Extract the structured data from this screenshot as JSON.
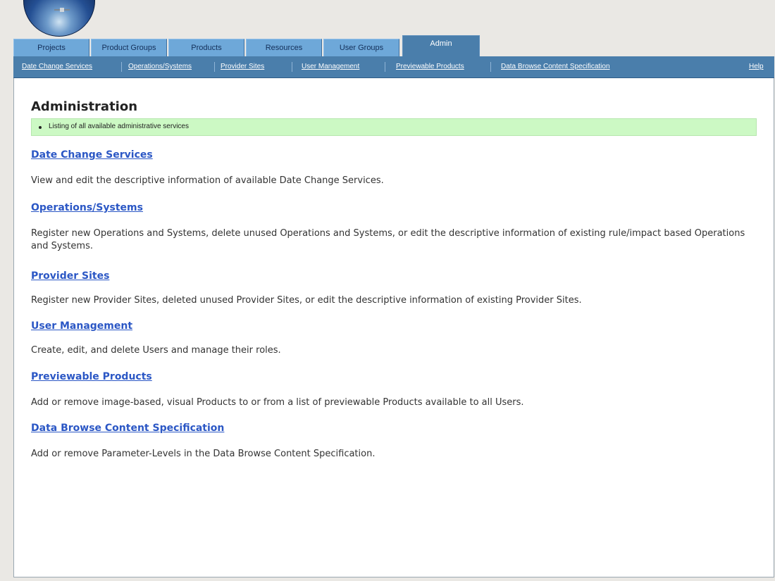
{
  "logo_icon": "globe-satellite-logo",
  "tabs": [
    {
      "label": "Projects"
    },
    {
      "label": "Product Groups"
    },
    {
      "label": "Products"
    },
    {
      "label": "Resources"
    },
    {
      "label": "User Groups"
    },
    {
      "label": "Admin",
      "active": true
    }
  ],
  "subnav": {
    "links": [
      {
        "label": "Date Change Services"
      },
      {
        "label": "Operations/Systems"
      },
      {
        "label": "Provider Sites"
      },
      {
        "label": "User Management"
      },
      {
        "label": "Previewable Products"
      },
      {
        "label": "Data Browse Content Specification"
      }
    ],
    "help": "Help"
  },
  "page": {
    "title": "Administration",
    "info": "Listing of all available administrative services"
  },
  "sections": [
    {
      "title": "Date Change Services",
      "description": "View and edit the descriptive information of available Date Change Services."
    },
    {
      "title": "Operations/Systems",
      "description": "Register new Operations and Systems, delete unused Operations and Systems, or edit the descriptive information of existing rule/impact based Operations and Systems."
    },
    {
      "title": "Provider Sites",
      "description": "Register new Provider Sites, deleted unused Provider Sites, or edit the descriptive information of existing Provider Sites."
    },
    {
      "title": "User Management",
      "description": "Create, edit, and delete Users and manage their roles."
    },
    {
      "title": "Previewable Products",
      "description": "Add or remove image-based, visual Products to or from a list of previewable Products available to all Users."
    },
    {
      "title": "Data Browse Content Specification",
      "description": "Add or remove Parameter-Levels in the Data Browse Content Specification."
    }
  ],
  "colors": {
    "tab": "#6ea8d9",
    "tab_active": "#4a7eab",
    "subnav": "#4a7eab",
    "link": "#2b57c5",
    "info_box": "#ccf9c4"
  }
}
